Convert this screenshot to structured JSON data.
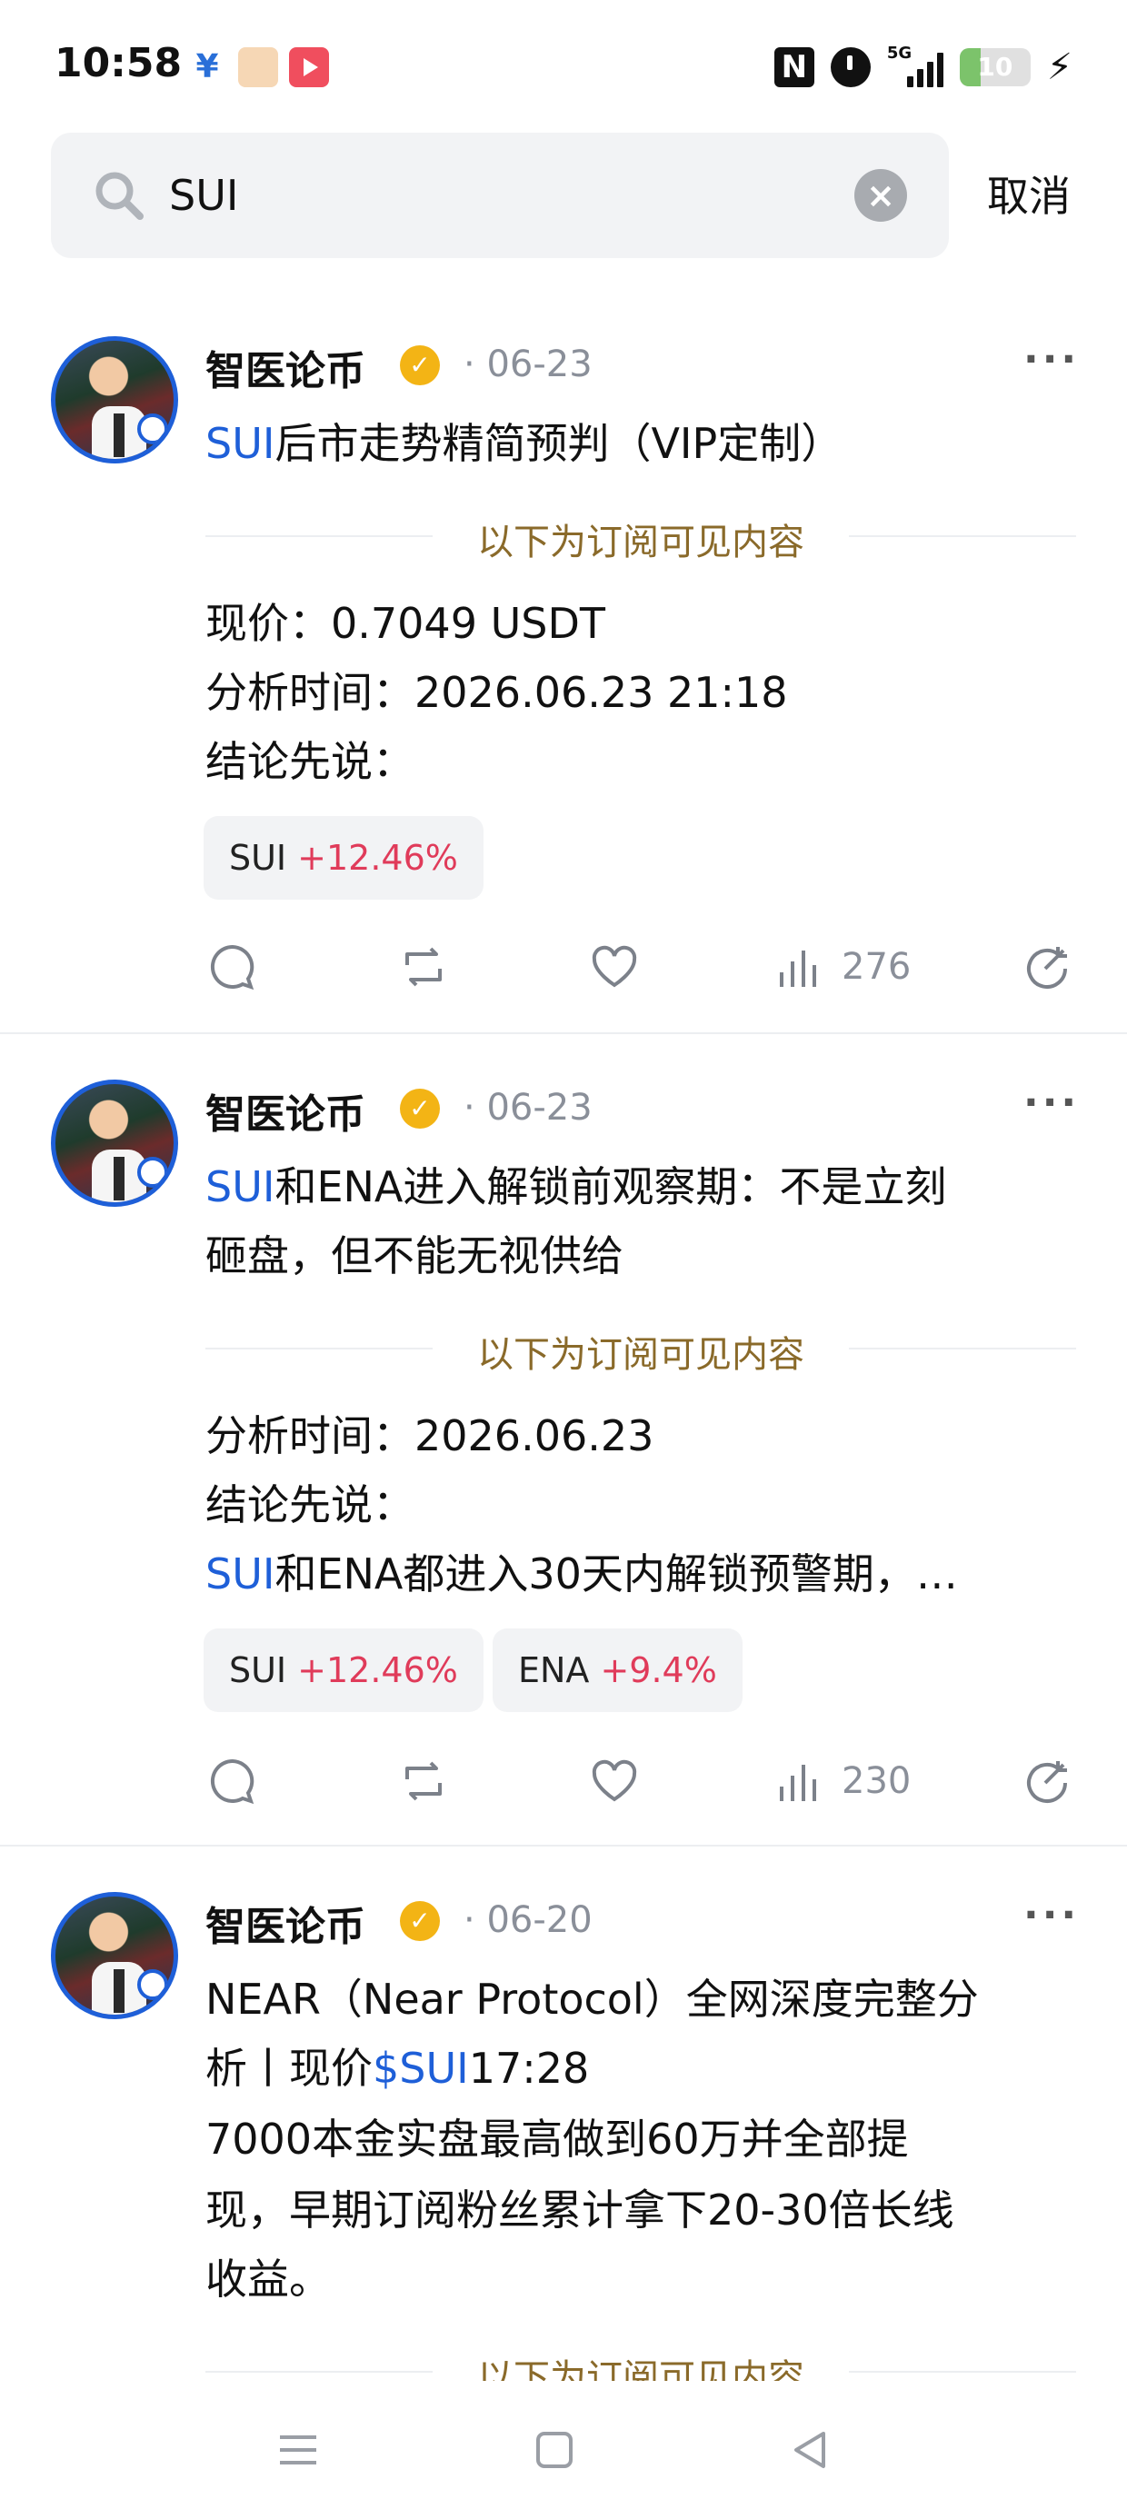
{
  "status_bar": {
    "time": "10:58",
    "network": "5G",
    "battery_level": "10",
    "icons": [
      "yuan-app-icon",
      "cartoon-app-icon",
      "video-app-icon",
      "nfc-icon",
      "alarm-icon",
      "signal-icon",
      "battery-icon",
      "charging-icon"
    ]
  },
  "search": {
    "query": "SUI",
    "cancel_label": "取消"
  },
  "colors": {
    "accent": "#1e5fd8",
    "gain": "#e03b5a",
    "verified": "#f3b415",
    "subscriber_label": "#8a6a2a"
  },
  "posts": [
    {
      "author": "智医论币",
      "date": "06-23",
      "title_highlight": "SUI",
      "title_rest": "后市走势精简预判（VIP定制）",
      "subscriber_label": "以下为订阅可见内容",
      "lines": [
        "现价：0.7049 USDT",
        "分析时间：2026.06.23 21:18",
        "结论先说："
      ],
      "tags": [
        {
          "symbol": "SUI",
          "change": "+12.46%"
        }
      ],
      "views": "276"
    },
    {
      "author": "智医论币",
      "date": "06-23",
      "title_highlight": "SUI",
      "title_rest_1": "和ENA进入解锁前观察期：不是立刻",
      "title_line2": "砸盘，但不能无视供给",
      "subscriber_label": "以下为订阅可见内容",
      "lines": [
        "分析时间：2026.06.23",
        "结论先说："
      ],
      "last_line_highlight": "SUI",
      "last_line_rest": "和ENA都进入30天内解锁预警期，…",
      "tags": [
        {
          "symbol": "SUI",
          "change": "+12.46%"
        },
        {
          "symbol": "ENA",
          "change": "+9.4%"
        }
      ],
      "views": "230"
    },
    {
      "author": "智医论币",
      "date": "06-20",
      "line1": "NEAR（Near Protocol）全网深度完整分",
      "line2_pre": "析丨现价",
      "line2_highlight": "$SUI",
      "line2_post": "17:28",
      "line3": "7000本金实盘最高做到60万并全部提",
      "line4": "现，早期订阅粉丝累计拿下20-30倍长线",
      "line5": "收益。",
      "subscriber_label": "以下为订阅可见内容"
    }
  ],
  "nav": {
    "buttons": [
      "menu-nav-icon",
      "home-nav-icon",
      "back-nav-icon"
    ]
  }
}
